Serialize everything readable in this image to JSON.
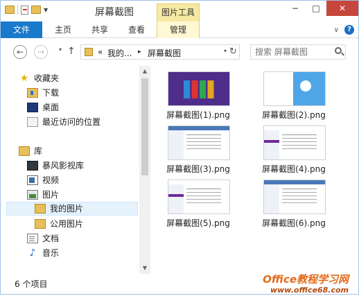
{
  "title_bar": {
    "title": "屏幕截图",
    "tool_tab": "图片工具",
    "min": "−",
    "max": "□",
    "close": "✕"
  },
  "ribbon": {
    "tabs": [
      "文件",
      "主页",
      "共享",
      "查看",
      "管理"
    ],
    "help": "?"
  },
  "address": {
    "back": "←",
    "forward": "→",
    "up": "↑",
    "root": "«",
    "crumbs": [
      "我的...",
      "屏幕截图"
    ],
    "separator": "▸",
    "refresh": "↻",
    "dropdown": "▾"
  },
  "search": {
    "placeholder": "搜索 屏幕截图"
  },
  "nav": {
    "items": [
      {
        "label": "收藏夹",
        "icon": "star-icon"
      },
      {
        "label": "下载",
        "icon": "download-folder-icon"
      },
      {
        "label": "桌面",
        "icon": "desktop-icon"
      },
      {
        "label": "最近访问的位置",
        "icon": "recent-places-icon"
      },
      {
        "label": "库",
        "icon": "library-icon"
      },
      {
        "label": "暴风影视库",
        "icon": "video-library-icon"
      },
      {
        "label": "视频",
        "icon": "videos-icon"
      },
      {
        "label": "图片",
        "icon": "pictures-icon"
      },
      {
        "label": "我的图片",
        "icon": "folder-icon"
      },
      {
        "label": "公用图片",
        "icon": "folder-icon"
      },
      {
        "label": "文档",
        "icon": "documents-icon"
      },
      {
        "label": "音乐",
        "icon": "music-icon"
      }
    ],
    "scroll_up": "▲",
    "scroll_down": "▼"
  },
  "files": [
    {
      "name": "屏幕截图(1).png",
      "thumb": "purple-start-screen"
    },
    {
      "name": "屏幕截图(2).png",
      "thumb": "blue-desktop"
    },
    {
      "name": "屏幕截图(3).png",
      "thumb": "white-window"
    },
    {
      "name": "屏幕截图(4).png",
      "thumb": "white-settings"
    },
    {
      "name": "屏幕截图(5).png",
      "thumb": "white-settings"
    },
    {
      "name": "屏幕截图(6).png",
      "thumb": "white-window"
    }
  ],
  "status": {
    "count": "6 个项目"
  },
  "watermark": {
    "line1": "Office教程学习网",
    "line2": "www.office68.com"
  },
  "colors": {
    "file_tab": "#1979ca",
    "tool_tab": "#f6e9a3",
    "close": "#c7463c",
    "selection": "#e5f1fb"
  }
}
